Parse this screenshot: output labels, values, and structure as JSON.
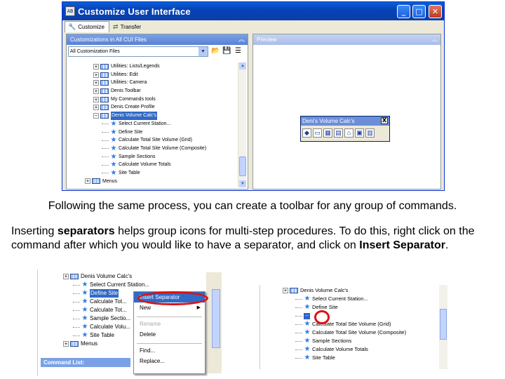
{
  "dialog": {
    "title": "Customize User Interface",
    "tabs": [
      {
        "label": "Customize",
        "icon": "wrench-icon"
      },
      {
        "label": "Transfer",
        "icon": "transfer-arrows-icon"
      }
    ],
    "left_panel_title": "Customizations in All CUI Files",
    "right_panel_title": "Preview",
    "filter_value": "All Customization Files",
    "tree_items": [
      {
        "label": "Utilities: Lists/Legends",
        "kind": "toolbar"
      },
      {
        "label": "Utilities: Edit",
        "kind": "toolbar"
      },
      {
        "label": "Utilities: Camera",
        "kind": "toolbar"
      },
      {
        "label": "Denis Toolbar",
        "kind": "toolbar"
      },
      {
        "label": "My Commands tools",
        "kind": "toolbar"
      },
      {
        "label": "Denis Create Profile",
        "kind": "toolbar"
      },
      {
        "label": "Denis Volume Calc's",
        "kind": "toolbar",
        "selected": true
      },
      {
        "label": "Select Current Station...",
        "kind": "command"
      },
      {
        "label": "Define Site",
        "kind": "command"
      },
      {
        "label": "Calculate Total Site Volume (Grid)",
        "kind": "command"
      },
      {
        "label": "Calculate Total Site Volume (Composite)",
        "kind": "command"
      },
      {
        "label": "Sample Sections",
        "kind": "command"
      },
      {
        "label": "Calculate Volume Totals",
        "kind": "command"
      },
      {
        "label": "Site Table",
        "kind": "command"
      },
      {
        "label": "Menus",
        "kind": "menu"
      }
    ],
    "floating_toolbar": {
      "title": "Deni's Volume Calc's",
      "close_glyph": "X",
      "icons": [
        "station-icon",
        "define-site-icon",
        "grid-volume-icon",
        "composite-volume-icon",
        "sections-icon",
        "totals-icon",
        "table-icon"
      ]
    }
  },
  "caption": "Following the same process, you can create a toolbar for any group of commands.",
  "paragraph": {
    "intro": "Inserting ",
    "term_separators": "separators",
    "middle": " helps group icons for multi-step procedures.  To do this, right click on the command after which you would like to have a separator, and click on ",
    "term_insert": "Insert Separator",
    "end": "."
  },
  "left_shot": {
    "tree_items": [
      {
        "label": "Denis Volume Calc's",
        "kind": "toolbar"
      },
      {
        "label": "Select Current Station...",
        "kind": "command"
      },
      {
        "label": "Define Site",
        "kind": "command",
        "selected": true
      },
      {
        "label": "Calculate Tot...",
        "kind": "command"
      },
      {
        "label": "Calculate Tot...",
        "kind": "command"
      },
      {
        "label": "Sample Sectio...",
        "kind": "command"
      },
      {
        "label": "Calculate Volu...",
        "kind": "command"
      },
      {
        "label": "Site Table",
        "kind": "command"
      },
      {
        "label": "Menus",
        "kind": "menu"
      }
    ],
    "context_menu": [
      {
        "label": "Insert Separator",
        "state": "highlight"
      },
      {
        "label": "New",
        "state": "submenu"
      },
      {
        "label": "",
        "state": "separator"
      },
      {
        "label": "Rename",
        "state": "disabled"
      },
      {
        "label": "Delete",
        "state": "normal"
      },
      {
        "label": "",
        "state": "separator"
      },
      {
        "label": "Find...",
        "state": "normal"
      },
      {
        "label": "Replace...",
        "state": "normal"
      }
    ],
    "command_list_title": "Command List:"
  },
  "right_shot": {
    "tree_items": [
      {
        "label": "Denis Volume Calc's",
        "kind": "toolbar"
      },
      {
        "label": "Select Current Station...",
        "kind": "command"
      },
      {
        "label": "Define Site",
        "kind": "command"
      },
      {
        "label": "--",
        "kind": "separator"
      },
      {
        "label": "Calculate Total Site Volume (Grid)",
        "kind": "command"
      },
      {
        "label": "Calculate Total Site Volume (Composite)",
        "kind": "command"
      },
      {
        "label": "Sample Sections",
        "kind": "command"
      },
      {
        "label": "Calculate Volume Totals",
        "kind": "command"
      },
      {
        "label": "Site Table",
        "kind": "command"
      }
    ]
  },
  "colors": {
    "title_bar": "#0a5fd8",
    "selection": "#316ac5",
    "highlight_ring": "#e01010"
  }
}
